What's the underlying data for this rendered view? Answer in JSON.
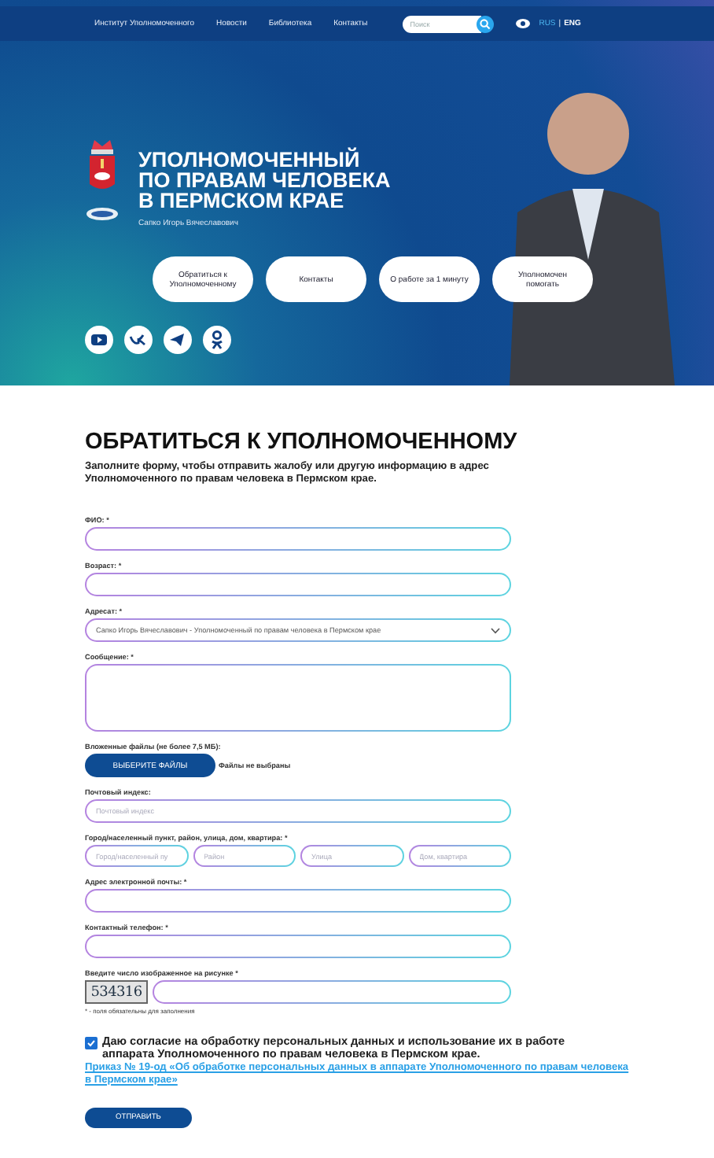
{
  "nav": {
    "links": [
      "Институт Уполномоченного",
      "Новости",
      "Библиотека",
      "Контакты"
    ],
    "search": {
      "placeholder": "Поиск"
    },
    "languages": [
      {
        "label": "RUS",
        "selected": true
      },
      {
        "label": "ENG",
        "selected": false
      }
    ],
    "language_separator": "|"
  },
  "hero": {
    "title_lines": [
      "УПОЛНОМОЧЕННЫЙ",
      "ПО ПРАВАМ ЧЕЛОВЕКА",
      "В ПЕРМСКОМ КРАЕ"
    ],
    "name": "Сапко Игорь Вячеславович",
    "buttons": [
      "Обратиться к Уполномоченному",
      "Контакты",
      "О работе за 1 минуту",
      "Уполномочен помогать"
    ],
    "socials": [
      {
        "kind": "video"
      },
      {
        "kind": "vk"
      },
      {
        "kind": "telegram"
      },
      {
        "kind": "ok"
      }
    ]
  },
  "form": {
    "title": "ОБРАТИТЬСЯ К УПОЛНОМОЧЕННОМУ",
    "intro": "Заполните форму, чтобы отправить жалобу или другую информацию в адрес Уполномоченного по правам человека в Пермском крае.",
    "fields": [
      {
        "kind": "text",
        "label": "ФИО: *"
      },
      {
        "kind": "text",
        "label": "Возраст: *"
      },
      {
        "kind": "select",
        "label": "Адресат: *",
        "value": "Сапко Игорь Вячеславович - Уполномоченный по правам человека в Пермском крае"
      },
      {
        "kind": "textarea",
        "label": "Сообщение: *"
      },
      {
        "kind": "file",
        "label": "Вложенные файлы (не более 7,5 МБ):",
        "button": "ВЫБЕРИТЕ ФАЙЛЫ",
        "status": "Файлы не выбраны"
      },
      {
        "kind": "text",
        "label": "Почтовый индекс:",
        "placeholder": "Почтовый индекс"
      },
      {
        "kind": "address",
        "label": "Город/населенный пункт, район, улица, дом, квартира: *",
        "placeholders": [
          "Город/населенный пу",
          "Район",
          "Улица",
          "Дом, квартира"
        ]
      },
      {
        "kind": "text",
        "label": "Адрес электронной почты: *"
      },
      {
        "kind": "text",
        "label": "Контактный телефон: *"
      },
      {
        "kind": "captcha",
        "label": "Введите число изображенное на рисунке *",
        "code": "534316"
      }
    ],
    "required_note": "* - поля обязательны для заполнения",
    "consent": {
      "checked": true,
      "text": "Даю согласие на обработку персональных данных и использование их в работе аппарата Уполномоченного по правам человека в Пермском крае."
    },
    "link": "Приказ № 19-од «Об обработке персональных данных в аппарате Уполномоченного по правам человека в Пермском крае»",
    "submit": "ОТПРАВИТЬ"
  }
}
